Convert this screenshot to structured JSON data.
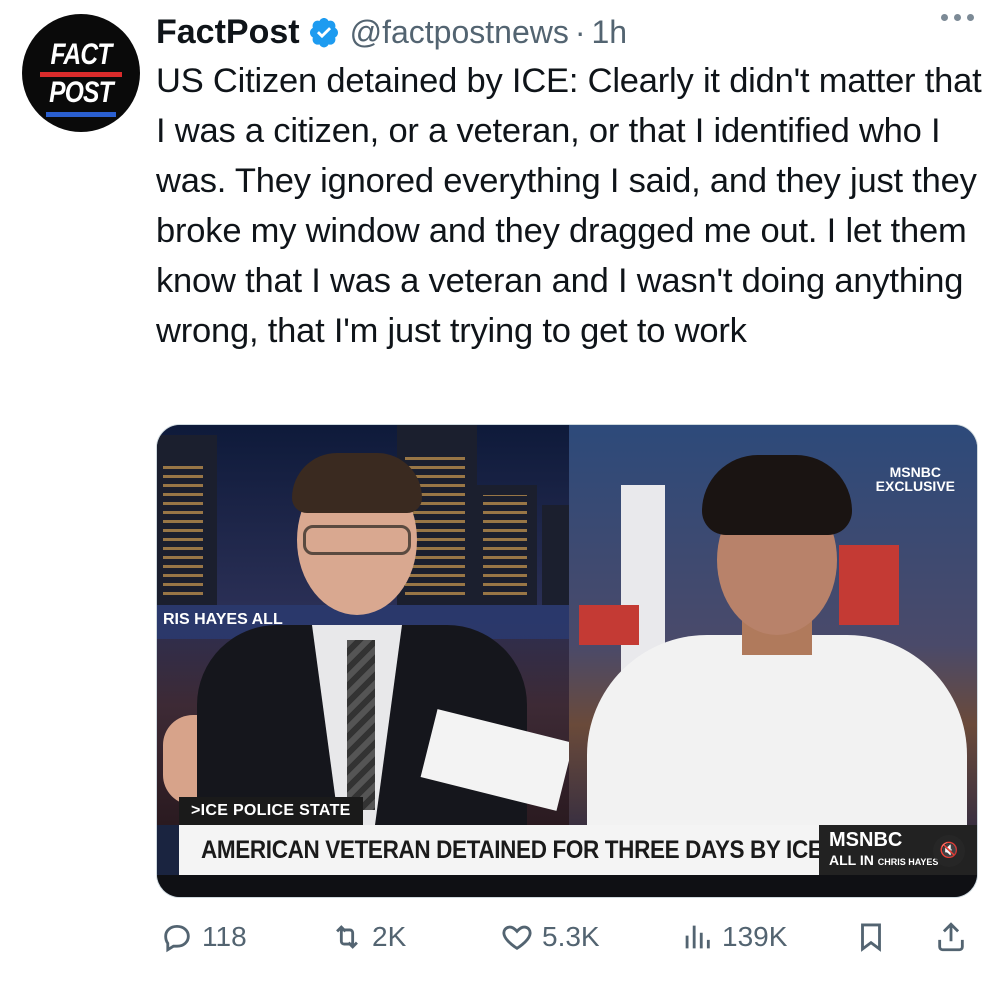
{
  "author": {
    "display_name": "FactPost",
    "handle": "@factpostnews",
    "separator": "·",
    "time": "1h",
    "avatar_text_line1": "FACT",
    "avatar_text_line2": "POST",
    "verified_color": "#1d9bf0"
  },
  "tweet": {
    "text": "US Citizen detained by ICE: Clearly it didn't matter that I was a citizen, or a veteran, or that I identified who I was. They ignored everything I said, and they just they broke my window and they dragged me out. I let them know that I was a veteran and I wasn't doing anything wrong, that I'm just trying to get to work"
  },
  "media": {
    "left_banner": "RIS HAYES  ALL",
    "top_right_logo_line1": "MSNBC",
    "top_right_logo_line2": "EXCLUSIVE",
    "segment_tag": ">ICE POLICE STATE",
    "headline": "AMERICAN VETERAN DETAINED FOR THREE DAYS BY ICE",
    "network_logo": "MSNBC",
    "show_logo": "ALL IN",
    "show_host": "CHRIS HAYES",
    "mute_icon": "speaker-muted-icon"
  },
  "actions": {
    "replies": "118",
    "reposts": "2K",
    "likes": "5.3K",
    "views": "139K",
    "bookmark_icon": "bookmark-icon",
    "share_icon": "share-icon"
  }
}
